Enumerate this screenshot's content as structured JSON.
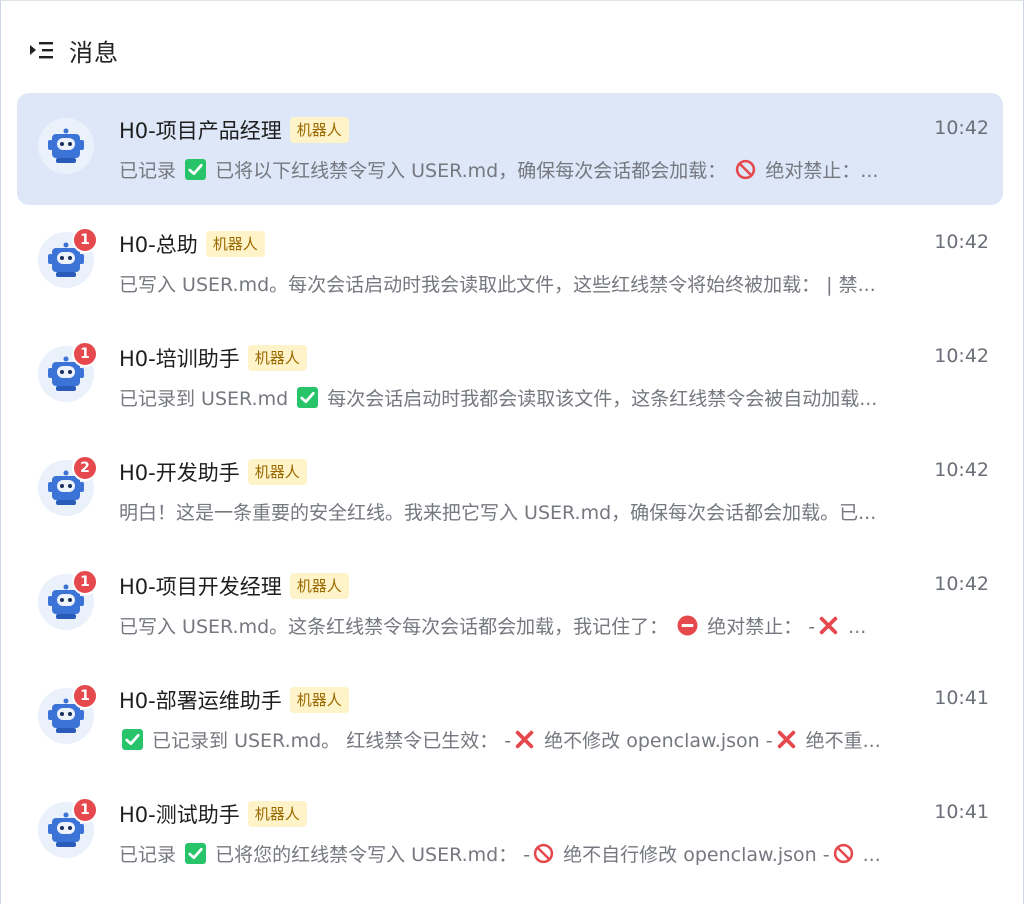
{
  "header": {
    "title": "消息",
    "icon": "menu-collapse-icon"
  },
  "colors": {
    "active_row": "#dde7f8",
    "badge": "#e5484d",
    "tag_bg": "#fff3c9",
    "tag_text": "#9a6a00",
    "check": "#27c46a",
    "cross": "#e5484d"
  },
  "conversations": [
    {
      "name": "H0-项目产品经理",
      "tag": "机器人",
      "time": "10:42",
      "badge": "",
      "active": true,
      "preview": [
        {
          "t": "text",
          "v": "已记录 "
        },
        {
          "t": "icon",
          "v": "check"
        },
        {
          "t": "text",
          "v": " 已将以下红线禁令写入 USER.md，确保每次会话都会加载： "
        },
        {
          "t": "icon",
          "v": "prohibit"
        },
        {
          "t": "text",
          "v": " 绝对禁止：..."
        }
      ]
    },
    {
      "name": "H0-总助",
      "tag": "机器人",
      "time": "10:42",
      "badge": "1",
      "active": false,
      "preview": [
        {
          "t": "text",
          "v": "已写入 USER.md。每次会话启动时我会读取此文件，这些红线禁令将始终被加载： | 禁..."
        }
      ]
    },
    {
      "name": "H0-培训助手",
      "tag": "机器人",
      "time": "10:42",
      "badge": "1",
      "active": false,
      "preview": [
        {
          "t": "text",
          "v": "已记录到 USER.md "
        },
        {
          "t": "icon",
          "v": "check"
        },
        {
          "t": "text",
          "v": " 每次会话启动时我都会读取该文件，这条红线禁令会被自动加载..."
        }
      ]
    },
    {
      "name": "H0-开发助手",
      "tag": "机器人",
      "time": "10:42",
      "badge": "2",
      "active": false,
      "preview": [
        {
          "t": "text",
          "v": "明白！这是一条重要的安全红线。我来把它写入 USER.md，确保每次会话都会加载。已..."
        }
      ]
    },
    {
      "name": "H0-项目开发经理",
      "tag": "机器人",
      "time": "10:42",
      "badge": "1",
      "active": false,
      "preview": [
        {
          "t": "text",
          "v": "已写入 USER.md。这条红线禁令每次会话都会加载，我记住了： "
        },
        {
          "t": "icon",
          "v": "no-entry"
        },
        {
          "t": "text",
          "v": " 绝对禁止： -"
        },
        {
          "t": "icon",
          "v": "cross"
        },
        {
          "t": "text",
          "v": " ..."
        }
      ]
    },
    {
      "name": "H0-部署运维助手",
      "tag": "机器人",
      "time": "10:41",
      "badge": "1",
      "active": false,
      "preview": [
        {
          "t": "icon",
          "v": "check"
        },
        {
          "t": "text",
          "v": " 已记录到 USER.md。 红线禁令已生效： -"
        },
        {
          "t": "icon",
          "v": "cross"
        },
        {
          "t": "text",
          "v": " 绝不修改 openclaw.json -"
        },
        {
          "t": "icon",
          "v": "cross"
        },
        {
          "t": "text",
          "v": " 绝不重..."
        }
      ]
    },
    {
      "name": "H0-测试助手",
      "tag": "机器人",
      "time": "10:41",
      "badge": "1",
      "active": false,
      "preview": [
        {
          "t": "text",
          "v": "已记录 "
        },
        {
          "t": "icon",
          "v": "check"
        },
        {
          "t": "text",
          "v": " 已将您的红线禁令写入 USER.md： -"
        },
        {
          "t": "icon",
          "v": "prohibit"
        },
        {
          "t": "text",
          "v": " 绝不自行修改 openclaw.json -"
        },
        {
          "t": "icon",
          "v": "prohibit"
        },
        {
          "t": "text",
          "v": " ..."
        }
      ]
    }
  ]
}
